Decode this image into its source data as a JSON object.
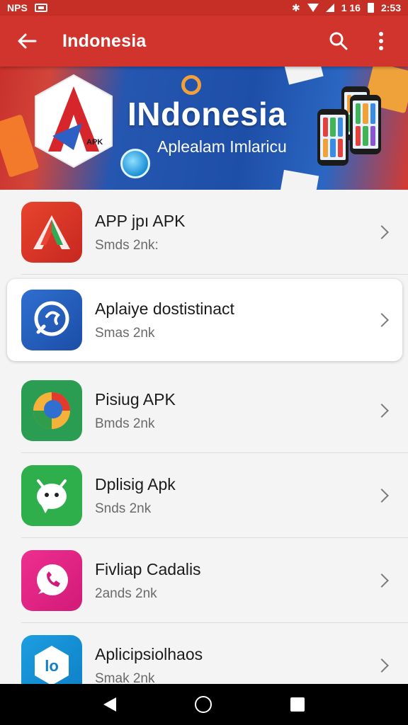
{
  "status_bar": {
    "left_text": "NPS",
    "time": "2:53",
    "indicator_text": "1 16"
  },
  "app_bar": {
    "title": "Indonesia",
    "back_icon": "arrow-back-icon",
    "search_icon": "search-icon",
    "menu_icon": "more-vert-icon"
  },
  "banner": {
    "title_part1": "INdonesia",
    "title_part2": "",
    "subtitle": "Aplealam Imlaricu",
    "logo_badge": "APK"
  },
  "apps": [
    {
      "title": "APP jpı APK",
      "subtitle": "Smds 2nk:",
      "icon": "red-a-icon"
    },
    {
      "title": "Aplaiye dostistinact",
      "subtitle": "Smas 2nk",
      "icon": "blue-chat-icon"
    },
    {
      "title": "Pisiug APK",
      "subtitle": "Bmds 2nk",
      "icon": "green-compass-icon"
    },
    {
      "title": "Dplisig Apk",
      "subtitle": "Snds 2nk",
      "icon": "green-bot-icon"
    },
    {
      "title": "Fivliap Cadalis",
      "subtitle": "2ands 2nk",
      "icon": "pink-phone-icon"
    },
    {
      "title": "Aplicipsiolhaos",
      "subtitle": "Smak 2nk",
      "icon": "blue-lo-icon"
    }
  ],
  "colors": {
    "app_bar": "#d0342c",
    "status_bar": "#c62f26",
    "nav_bar": "#000000"
  }
}
